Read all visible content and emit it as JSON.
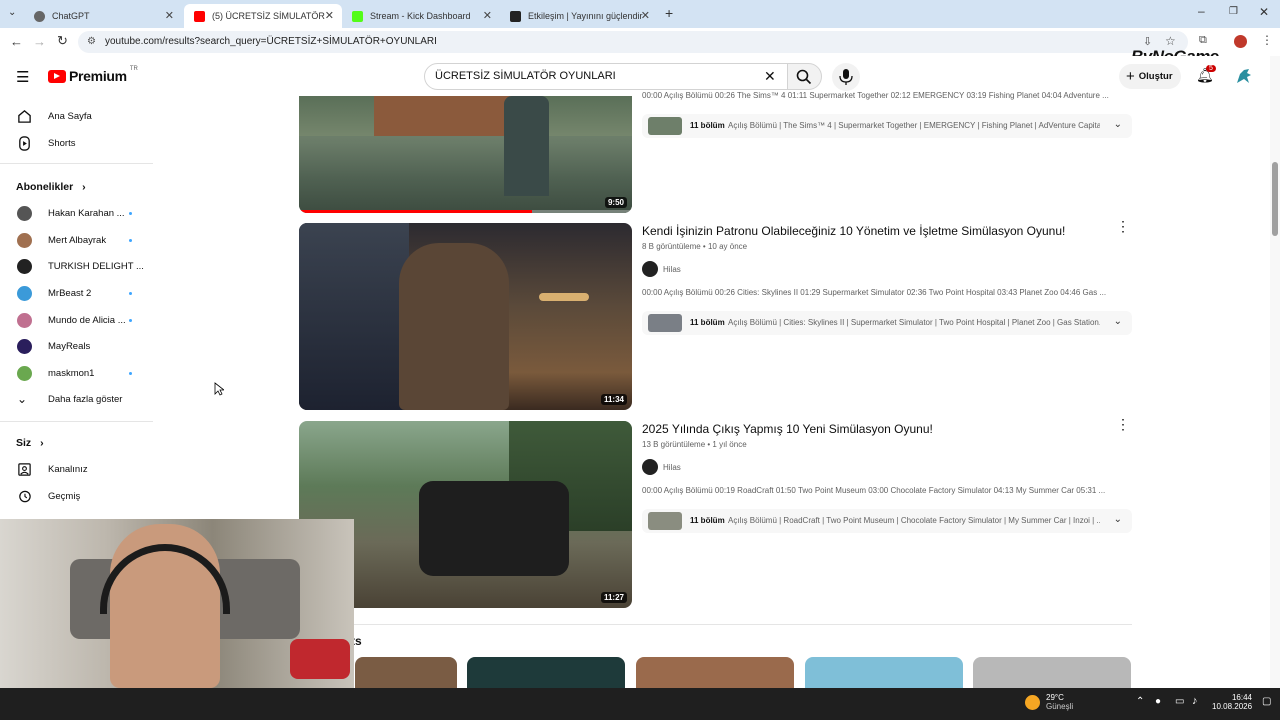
{
  "browser": {
    "tabs": [
      {
        "title": "ChatGPT",
        "color": "#666666"
      },
      {
        "title": "(5) ÜCRETSİZ SİMULATÖR OYUN",
        "color": "#ff0000"
      },
      {
        "title": "Stream - Kick Dashboard",
        "color": "#53fc18"
      },
      {
        "title": "Etkileşim | Yayınını güçlendirme",
        "color": "#222222"
      }
    ],
    "url": "youtube.com/results?search_query=ÜCRETSİZ+SİMULATÖR+OYUNLARI",
    "overlay_logo": "ByNoGame"
  },
  "header": {
    "logo": "Premium",
    "region": "TR",
    "search_value": "ÜCRETSİZ SİMULATÖR OYUNLARI",
    "create_label": "Oluştur",
    "notif_count": "5"
  },
  "sidebar": {
    "home": "Ana Sayfa",
    "shorts": "Shorts",
    "subs_heading": "Abonelikler",
    "subs": [
      {
        "name": "Hakan Karahan ...",
        "color": "#555555",
        "dot": true
      },
      {
        "name": "Mert Albayrak",
        "color": "#a07050",
        "dot": true
      },
      {
        "name": "TURKISH DELIGHT ...",
        "color": "#222222",
        "dot": false
      },
      {
        "name": "MrBeast 2",
        "color": "#3b9ad9",
        "dot": true
      },
      {
        "name": "Mundo de Alicia ...",
        "color": "#c07090",
        "dot": true
      },
      {
        "name": "MayReals",
        "color": "#2a1e5c",
        "dot": false
      },
      {
        "name": "maskmon1",
        "color": "#6aa84f",
        "dot": true
      }
    ],
    "show_more": "Daha fazla göster",
    "you_heading": "Siz",
    "channel": "Kanalınız",
    "history": "Geçmiş"
  },
  "videos": [
    {
      "title": "",
      "meta": "",
      "desc": "00:00 Açılış Bölümü 00:26 The Sims™ 4 01:11 Supermarket Together 02:12 EMERGENCY 03:19 Fishing Planet 04:04 Adventure ...",
      "chapters_count": "11 bölüm",
      "chapters": "Açılış Bölümü | The Sims™ 4 | Supermarket Together | EMERGENCY | Fishing Planet | AdVenture Capitali...",
      "duration": "9:50",
      "progress": 0.7
    },
    {
      "title": "Kendi İşinizin Patronu Olabileceğiniz 10 Yönetim ve İşletme Simülasyon Oyunu!",
      "meta": "8 B görüntüleme • 10 ay önce",
      "channel": "Hilas",
      "desc": "00:00 Açılış Bölümü 00:26 Cities: Skylines II 01:29 Supermarket Simulator 02:36 Two Point Hospital 03:43 Planet Zoo 04:46 Gas ...",
      "chapters_count": "11 bölüm",
      "chapters": "Açılış Bölümü | Cities: Skylines II | Supermarket Simulator | Two Point Hospital | Planet Zoo | Gas Station...",
      "duration": "11:34"
    },
    {
      "title": "2025 Yılında Çıkış Yapmış 10 Yeni Simülasyon Oyunu!",
      "meta": "13 B görüntüleme • 1 yıl önce",
      "channel": "Hilas",
      "desc": "00:00 Açılış Bölümü 00:19 RoadCraft 01:50 Two Point Museum 03:00 Chocolate Factory Simulator 04:13 My Summer Car 05:31 ...",
      "chapters_count": "11 bölüm",
      "chapters": "Açılış Bölümü | RoadCraft | Two Point Museum | Chocolate Factory Simulator | My Summer Car | Inzoi | ...",
      "duration": "11:27"
    }
  ],
  "shorts_heading_tail": "ts",
  "taskbar": {
    "weather_temp": "29°C",
    "weather_desc": "Güneşli",
    "time": "16:44",
    "date": "10.08.2026"
  }
}
